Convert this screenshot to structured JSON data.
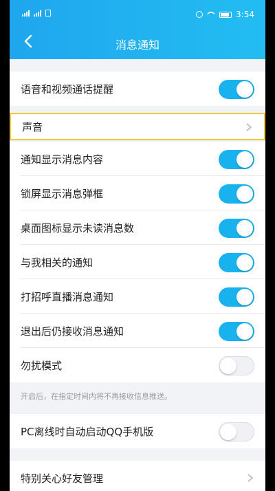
{
  "status": {
    "time": "3:54"
  },
  "header": {
    "title": "消息通知"
  },
  "settings": {
    "call_reminder": {
      "label": "语音和视频通话提醒",
      "enabled": true
    },
    "sound": {
      "label": "声音"
    },
    "show_content": {
      "label": "通知显示消息内容",
      "enabled": true
    },
    "lockscreen_popup": {
      "label": "锁屏显示消息弹框",
      "enabled": true
    },
    "unread_badge": {
      "label": "桌面图标显示未读消息数",
      "enabled": true
    },
    "related_notify": {
      "label": "与我相关的通知",
      "enabled": true
    },
    "live_notify": {
      "label": "打招呼直播消息通知",
      "enabled": true
    },
    "after_logout": {
      "label": "退出后仍接收消息通知",
      "enabled": true
    },
    "dnd": {
      "label": "勿扰模式",
      "enabled": false,
      "hint": "开启后，在指定时间内将不再接收信息推送。"
    },
    "pc_offline": {
      "label": "PC离线时自动启动QQ手机版",
      "enabled": false
    },
    "special_friends": {
      "label": "特别关心好友管理"
    }
  }
}
